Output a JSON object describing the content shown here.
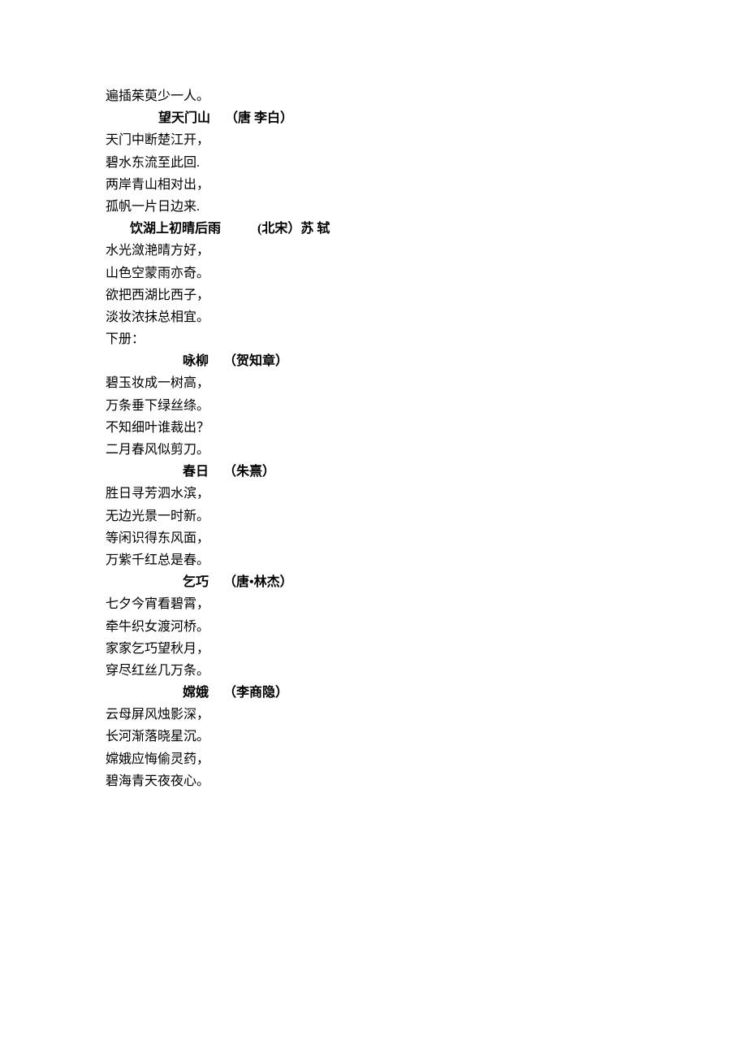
{
  "lines": [
    {
      "type": "line",
      "text": "遍插茱萸少一人。"
    },
    {
      "type": "title",
      "title": "望天门山",
      "author": "（唐  李白）"
    },
    {
      "type": "line",
      "text": "天门中断楚江开，"
    },
    {
      "type": "line",
      "text": "碧水东流至此回."
    },
    {
      "type": "line",
      "text": "两岸青山相对出，"
    },
    {
      "type": "line",
      "text": "孤帆一片日边来."
    },
    {
      "type": "title_wide",
      "title": "饮湖上初晴后雨",
      "author": "(北宋）苏  轼",
      "indent": 30,
      "gap": 45
    },
    {
      "type": "line",
      "text": "水光潋滟晴方好，"
    },
    {
      "type": "line",
      "text": "山色空蒙雨亦奇。"
    },
    {
      "type": "line",
      "text": "欲把西湖比西子，"
    },
    {
      "type": "line",
      "text": "淡妆浓抹总相宜。"
    },
    {
      "type": "section",
      "text": "下册："
    },
    {
      "type": "title",
      "title": "咏柳",
      "author": "（贺知章）",
      "indent": 95
    },
    {
      "type": "line",
      "text": "碧玉妆成一树高，"
    },
    {
      "type": "line",
      "text": "万条垂下绿丝绦。"
    },
    {
      "type": "line",
      "text": "不知细叶谁裁出？"
    },
    {
      "type": "line",
      "text": "二月春风似剪刀。"
    },
    {
      "type": "title",
      "title": "春日",
      "author": "（朱熹）",
      "indent": 95
    },
    {
      "type": "line",
      "text": "胜日寻芳泗水滨，"
    },
    {
      "type": "line",
      "text": "无边光景一时新。"
    },
    {
      "type": "line",
      "text": "等闲识得东风面，"
    },
    {
      "type": "line",
      "text": "万紫千红总是春。"
    },
    {
      "type": "title",
      "title": "乞巧",
      "author": "（唐•林杰）",
      "indent": 95
    },
    {
      "type": "line",
      "text": "七夕今宵看碧霄，"
    },
    {
      "type": "line",
      "text": "牵牛织女渡河桥。"
    },
    {
      "type": "line",
      "text": "家家乞巧望秋月，"
    },
    {
      "type": "line",
      "text": "穿尽红丝几万条。"
    },
    {
      "type": "title",
      "title": "嫦娥",
      "author": "（李商隐）",
      "indent": 95
    },
    {
      "type": "line",
      "text": "云母屏风烛影深，"
    },
    {
      "type": "line",
      "text": "长河渐落晓星沉。"
    },
    {
      "type": "line",
      "text": "嫦娥应悔偷灵药，"
    },
    {
      "type": "line",
      "text": "碧海青天夜夜心。"
    }
  ]
}
